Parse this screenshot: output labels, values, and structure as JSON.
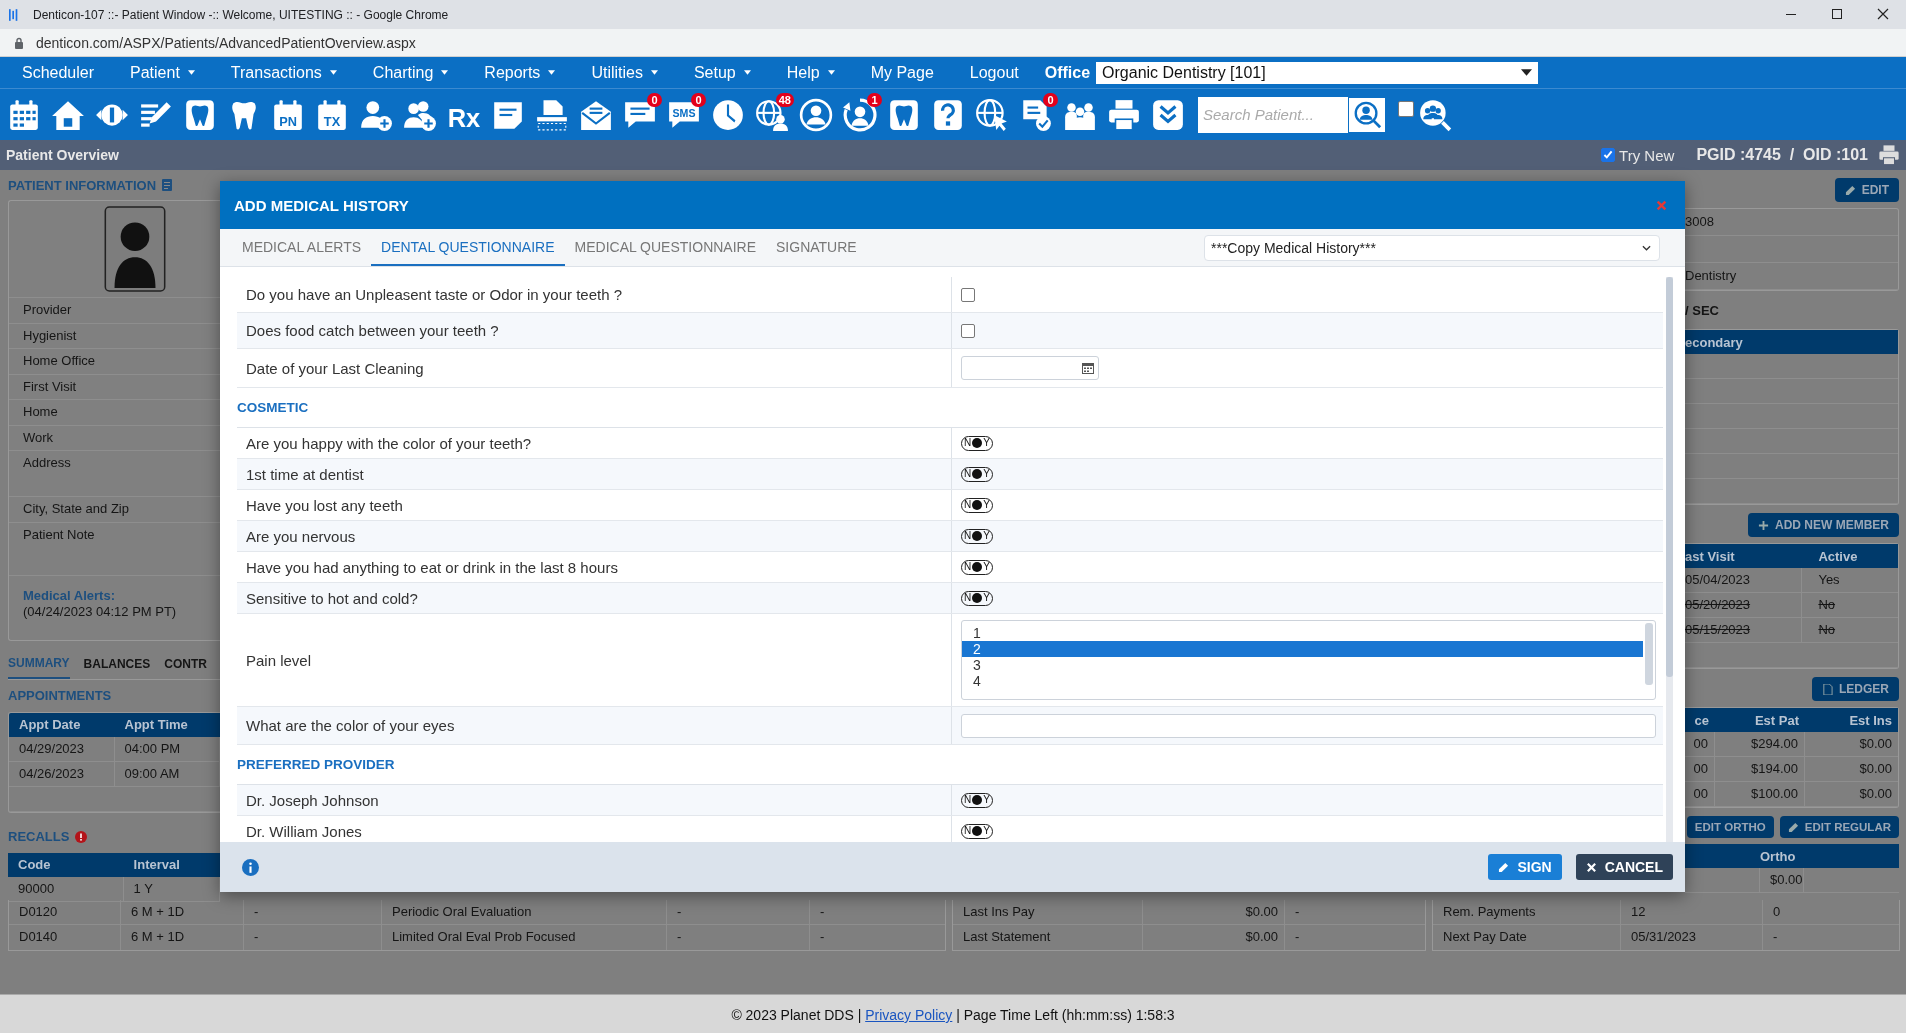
{
  "browser": {
    "title": "Denticon-107 ::- Patient Window -:: Welcome, UITESTING :: - Google Chrome",
    "url": "denticon.com/ASPX/Patients/AdvancedPatientOverview.aspx"
  },
  "menu": [
    {
      "label": "Scheduler",
      "dropdown": false
    },
    {
      "label": "Patient",
      "dropdown": true
    },
    {
      "label": "Transactions",
      "dropdown": true
    },
    {
      "label": "Charting",
      "dropdown": true
    },
    {
      "label": "Reports",
      "dropdown": true
    },
    {
      "label": "Utilities",
      "dropdown": true
    },
    {
      "label": "Setup",
      "dropdown": true
    },
    {
      "label": "Help",
      "dropdown": true
    },
    {
      "label": "My Page",
      "dropdown": false
    },
    {
      "label": "Logout",
      "dropdown": false
    }
  ],
  "office": {
    "label": "Office",
    "value": "Organic Dentistry [101]"
  },
  "toolbar": [
    {
      "kind": "calendar"
    },
    {
      "kind": "home"
    },
    {
      "kind": "coin"
    },
    {
      "kind": "pencil-list"
    },
    {
      "kind": "tooth-box"
    },
    {
      "kind": "tooth"
    },
    {
      "kind": "calendar-label",
      "label": "PN"
    },
    {
      "kind": "calendar-label",
      "label": "TX"
    },
    {
      "kind": "add-person"
    },
    {
      "kind": "add-people"
    },
    {
      "kind": "rx",
      "label": "Rx"
    },
    {
      "kind": "note"
    },
    {
      "kind": "scanner"
    },
    {
      "kind": "mail"
    },
    {
      "kind": "chat",
      "badge": "0"
    },
    {
      "kind": "sms",
      "label": "SMS",
      "badge": "0"
    },
    {
      "kind": "clock"
    },
    {
      "kind": "globe-person",
      "badge": "48"
    },
    {
      "kind": "globe-user"
    },
    {
      "kind": "person-refresh",
      "badge": "1"
    },
    {
      "kind": "tooth-box"
    },
    {
      "kind": "help-box"
    },
    {
      "kind": "globe-cursor"
    },
    {
      "kind": "doc-check",
      "badge": "0"
    },
    {
      "kind": "family"
    },
    {
      "kind": "printer"
    },
    {
      "kind": "chevrons"
    }
  ],
  "search": {
    "placeholder": "Search Patient...",
    "checked": false
  },
  "page_header": {
    "title": "Patient Overview",
    "try_new": {
      "label": "Try New",
      "checked": true
    },
    "ids": "PGID :4745  /  OID :101"
  },
  "patient_info": {
    "title": "PATIENT INFORMATION",
    "fields": [
      "Provider",
      "Hygienist",
      "Home Office",
      "First Visit",
      "Home",
      "Work",
      "Address",
      "City, State and Zip",
      "Patient Note"
    ],
    "alerts_label": "Medical Alerts:",
    "alerts_date": "(04/24/2023 04:12 PM PT)"
  },
  "summary_tabs": [
    {
      "label": "SUMMARY",
      "selected": true
    },
    {
      "label": "BALANCES",
      "selected": false
    },
    {
      "label": "CONTR",
      "selected": false
    }
  ],
  "appointments": {
    "title": "APPOINTMENTS",
    "columns": [
      "Appt Date",
      "Appt Time"
    ],
    "rows": [
      [
        "04/29/2023",
        "04:00 PM"
      ],
      [
        "04/26/2023",
        "09:00 AM"
      ]
    ]
  },
  "recalls": {
    "title": "RECALLS",
    "columns": [
      "Code",
      "Interval"
    ],
    "rows": [
      [
        "90000",
        "1 Y"
      ],
      [
        "D0120",
        "6 M + 1D",
        "-",
        "Periodic Oral Evaluation",
        "-",
        "-"
      ],
      [
        "D0140",
        "6 M + 1D",
        "-",
        "Limited Oral Eval Prob Focused",
        "-",
        "-"
      ]
    ]
  },
  "insurance_summary": {
    "rows": [
      [
        "Last Ins Pay",
        "$0.00",
        "-"
      ],
      [
        "Last Statement",
        "$0.00",
        "-"
      ]
    ]
  },
  "patient_details": {
    "edit": "EDIT",
    "rows": [
      "3008",
      "Dentistry"
    ],
    "coverage": "/ SEC",
    "columns": [
      "econdary"
    ]
  },
  "family": {
    "button": "ADD NEW MEMBER",
    "columns": [
      "ast Visit",
      "Active"
    ],
    "rows": [
      {
        "last_visit": "05/04/2023",
        "active": "Yes",
        "inactive": false
      },
      {
        "last_visit": "05/20/2023",
        "active": "No",
        "inactive": true
      },
      {
        "last_visit": "05/15/2023",
        "active": "No",
        "inactive": true
      }
    ]
  },
  "ledger": {
    "button": "LEDGER",
    "columns": [
      "ce",
      "Est Pat",
      "Est Ins"
    ],
    "rows": [
      [
        "00",
        "$294.00",
        "$0.00"
      ],
      [
        "00",
        "$194.00",
        "$0.00"
      ],
      [
        "00",
        "$100.00",
        "$0.00"
      ]
    ]
  },
  "payment_plan": {
    "buttons": [
      "EDIT ORTHO",
      "EDIT REGULAR"
    ],
    "columns": [
      "Ortho"
    ],
    "rows": [
      [
        "$0.00"
      ],
      [
        "Rem. Payments",
        "12",
        "0"
      ],
      [
        "Next Pay Date",
        "05/31/2023",
        "-"
      ]
    ]
  },
  "dialog": {
    "title": "ADD MEDICAL HISTORY",
    "tabs": [
      {
        "label": "MEDICAL ALERTS",
        "selected": false
      },
      {
        "label": "DENTAL QUESTIONNAIRE",
        "selected": true
      },
      {
        "label": "MEDICAL QUESTIONNAIRE",
        "selected": false
      },
      {
        "label": "SIGNATURE",
        "selected": false
      }
    ],
    "copy_select": "***Copy Medical History***",
    "items": [
      {
        "kind": "checkbox",
        "question": "Do you have an Unpleasent taste or Odor in your teeth ?",
        "checked": false
      },
      {
        "kind": "checkbox",
        "question": "Does food catch between your teeth ?",
        "checked": false
      },
      {
        "kind": "date",
        "question": "Date of your Last Cleaning"
      },
      {
        "kind": "section",
        "title": "COSMETIC"
      },
      {
        "kind": "toggle",
        "question": "Are you happy with the color of your teeth?",
        "answered": false,
        "no": "N",
        "yes": "Y"
      },
      {
        "kind": "toggle",
        "question": "1st time at dentist",
        "answered": false,
        "no": "N",
        "yes": "Y"
      },
      {
        "kind": "toggle",
        "question": "Have you lost any teeth",
        "answered": false,
        "no": "N",
        "yes": "Y"
      },
      {
        "kind": "toggle",
        "question": "Are you nervous",
        "answered": false,
        "no": "N",
        "yes": "Y"
      },
      {
        "kind": "toggle",
        "question": "Have you had anything to eat or drink in the last 8 hours",
        "answered": false,
        "no": "N",
        "yes": "Y"
      },
      {
        "kind": "toggle",
        "question": "Sensitive to hot and cold?",
        "answered": false,
        "no": "N",
        "yes": "Y"
      },
      {
        "kind": "listbox",
        "question": "Pain level",
        "options": [
          {
            "label": "1",
            "selected": false
          },
          {
            "label": "2",
            "selected": true
          },
          {
            "label": "3",
            "selected": false
          },
          {
            "label": "4",
            "selected": false
          }
        ]
      },
      {
        "kind": "text",
        "question": "What are the color of your eyes"
      },
      {
        "kind": "section",
        "title": "PREFERRED PROVIDER"
      },
      {
        "kind": "toggle",
        "question": "Dr. Joseph Johnson",
        "answered": false,
        "no": "N",
        "yes": "Y"
      },
      {
        "kind": "toggle",
        "question": "Dr. William Jones",
        "answered": false,
        "no": "N",
        "yes": "Y"
      }
    ],
    "buttons": [
      {
        "kind": "sign",
        "label": "SIGN"
      },
      {
        "kind": "cancel",
        "label": "CANCEL"
      }
    ]
  },
  "footer": {
    "copyright": "© 2023 Planet DDS |",
    "link": "Privacy Policy",
    "time_left": "| Page Time Left (hh:mm:ss) 1:58:3"
  }
}
